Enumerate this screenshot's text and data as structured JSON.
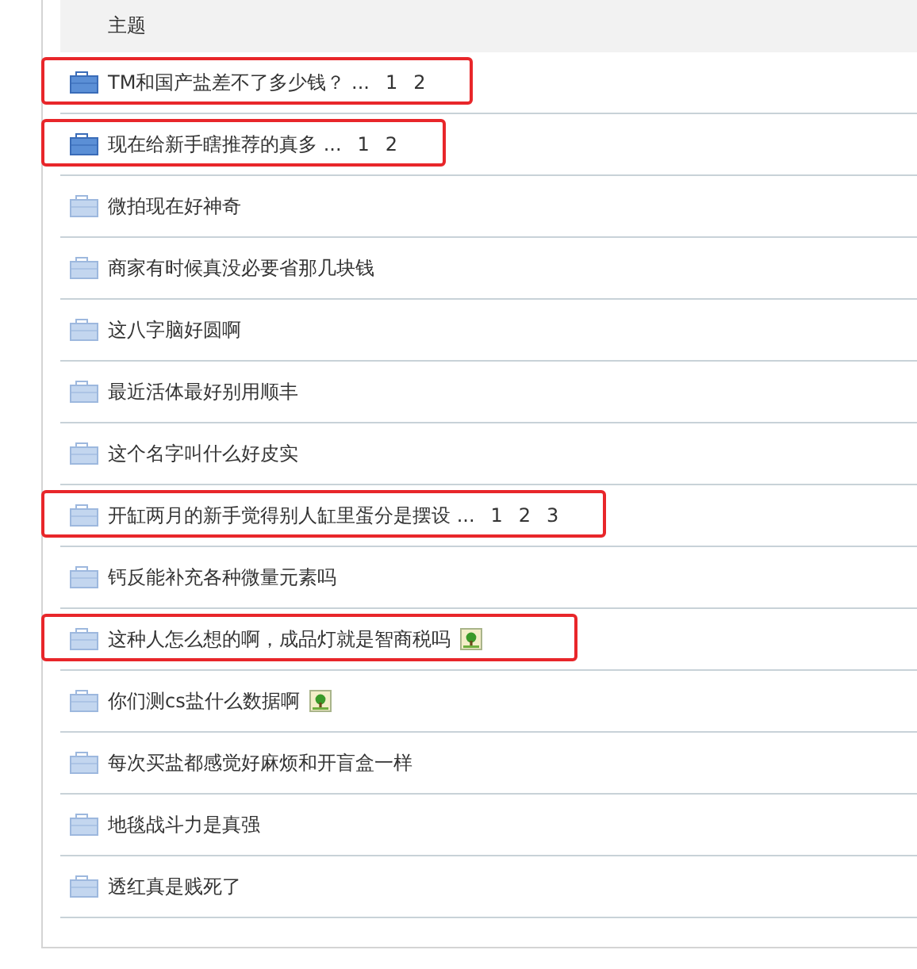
{
  "header": {
    "title": "主题"
  },
  "threads": [
    {
      "title": "TM和国产盐差不了多少钱？ ...",
      "pages": [
        "1",
        "2"
      ],
      "hot": true,
      "has_image": false,
      "highlighted": true
    },
    {
      "title": "现在给新手瞎推荐的真多 ...",
      "pages": [
        "1",
        "2"
      ],
      "hot": true,
      "has_image": false,
      "highlighted": true
    },
    {
      "title": "微拍现在好神奇",
      "hot": false,
      "has_image": false,
      "highlighted": false
    },
    {
      "title": "商家有时候真没必要省那几块钱",
      "hot": false,
      "has_image": false,
      "highlighted": false
    },
    {
      "title": "这八字脑好圆啊",
      "hot": false,
      "has_image": false,
      "highlighted": false
    },
    {
      "title": "最近活体最好别用顺丰",
      "hot": false,
      "has_image": false,
      "highlighted": false
    },
    {
      "title": "这个名字叫什么好皮实",
      "hot": false,
      "has_image": false,
      "highlighted": false
    },
    {
      "title": "开缸两月的新手觉得别人缸里蛋分是摆设 ...",
      "pages": [
        "1",
        "2",
        "3"
      ],
      "hot": false,
      "has_image": false,
      "highlighted": true
    },
    {
      "title": "钙反能补充各种微量元素吗",
      "hot": false,
      "has_image": false,
      "highlighted": false
    },
    {
      "title": "这种人怎么想的啊，成品灯就是智商税吗",
      "hot": false,
      "has_image": true,
      "highlighted": true
    },
    {
      "title": "你们测cs盐什么数据啊",
      "hot": false,
      "has_image": true,
      "highlighted": false
    },
    {
      "title": "每次买盐都感觉好麻烦和开盲盒一样",
      "hot": false,
      "has_image": false,
      "highlighted": false
    },
    {
      "title": "地毯战斗力是真强",
      "hot": false,
      "has_image": false,
      "highlighted": false
    },
    {
      "title": "透红真是贱死了",
      "hot": false,
      "has_image": false,
      "highlighted": false
    }
  ]
}
